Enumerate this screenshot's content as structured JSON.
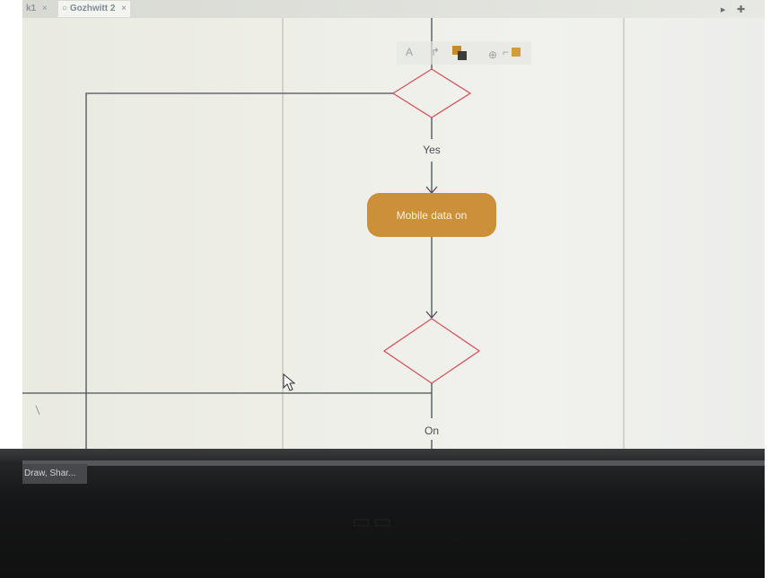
{
  "tabs": [
    {
      "label": "k1",
      "close": "×"
    },
    {
      "label": "Gozhwitt 2",
      "close": "×"
    }
  ],
  "toolbar": {
    "text_tool": "A"
  },
  "diagram": {
    "yes_label": "Yes",
    "process_label": "Mobile data on",
    "on_label": "On"
  },
  "taskbar": {
    "item_label": "Draw, Shar..."
  },
  "colors": {
    "process_fill": "#cc8f3a",
    "decision_stroke": "#d6545c",
    "connector": "#4a4f55"
  }
}
